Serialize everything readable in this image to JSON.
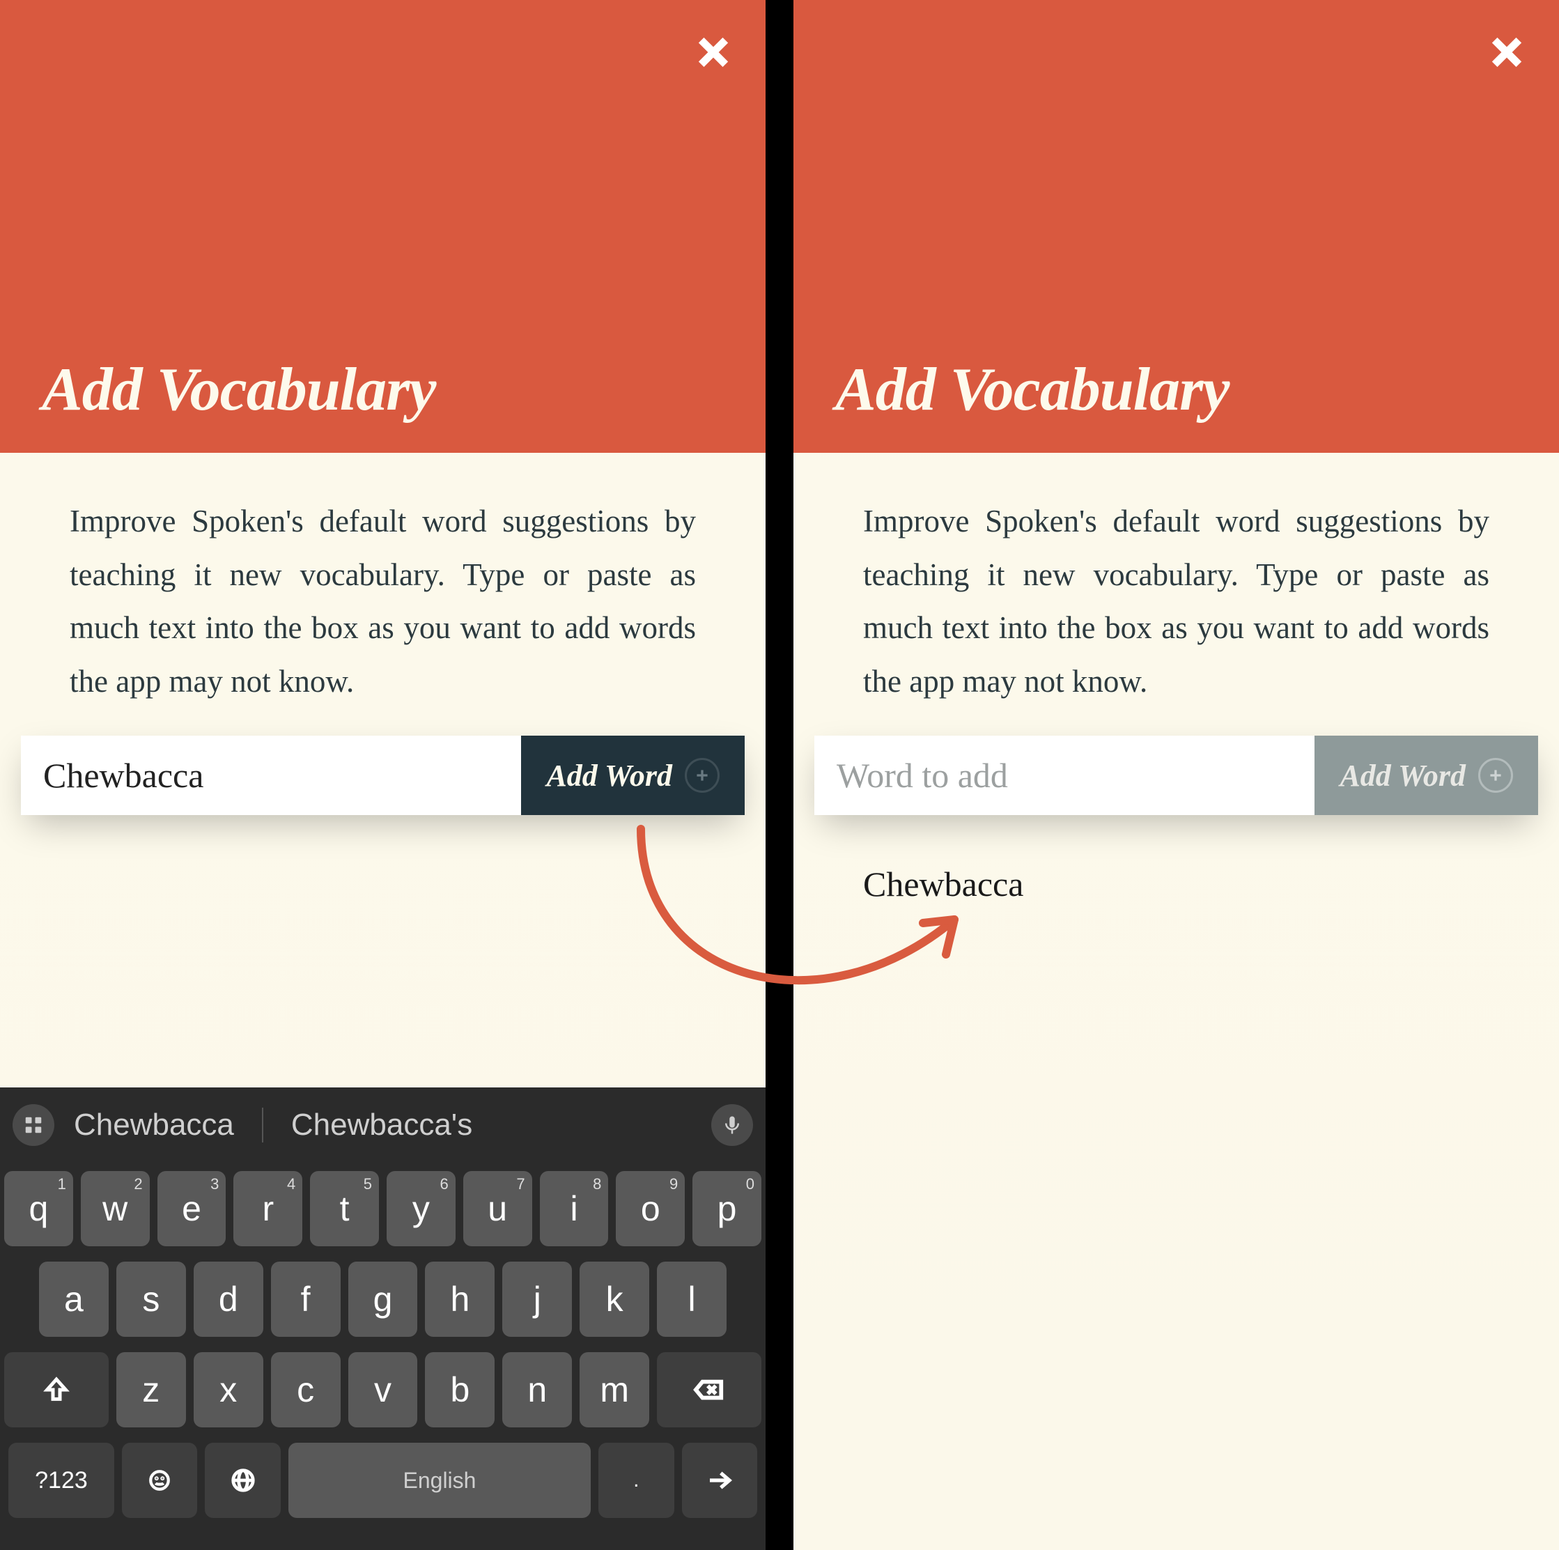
{
  "screens": {
    "left": {
      "title": "Add Vocabulary",
      "body": "Improve Spoken's default word suggestions by teaching it new vocabulary. Type or paste as much text into the box as you want to add words the app may not know.",
      "input_value": "Chewbacca",
      "input_placeholder": "Word to add",
      "add_button_label": "Add Word",
      "add_button_enabled": true
    },
    "right": {
      "title": "Add Vocabulary",
      "body": "Improve Spoken's default word suggestions by teaching it new vocabulary. Type or paste as much text into the box as you want to add words the app may not know.",
      "input_value": "",
      "input_placeholder": "Word to add",
      "add_button_label": "Add Word",
      "add_button_enabled": false,
      "added_words": [
        "Chewbacca"
      ]
    }
  },
  "keyboard": {
    "suggestions": [
      "Chewbacca",
      "Chewbacca's"
    ],
    "rows": {
      "r1": [
        {
          "k": "q",
          "s": "1"
        },
        {
          "k": "w",
          "s": "2"
        },
        {
          "k": "e",
          "s": "3"
        },
        {
          "k": "r",
          "s": "4"
        },
        {
          "k": "t",
          "s": "5"
        },
        {
          "k": "y",
          "s": "6"
        },
        {
          "k": "u",
          "s": "7"
        },
        {
          "k": "i",
          "s": "8"
        },
        {
          "k": "o",
          "s": "9"
        },
        {
          "k": "p",
          "s": "0"
        }
      ],
      "r2": [
        "a",
        "s",
        "d",
        "f",
        "g",
        "h",
        "j",
        "k",
        "l"
      ],
      "r3": [
        "z",
        "x",
        "c",
        "v",
        "b",
        "n",
        "m"
      ]
    },
    "sym_key": "?123",
    "space_label": "English",
    "period_key": "."
  }
}
